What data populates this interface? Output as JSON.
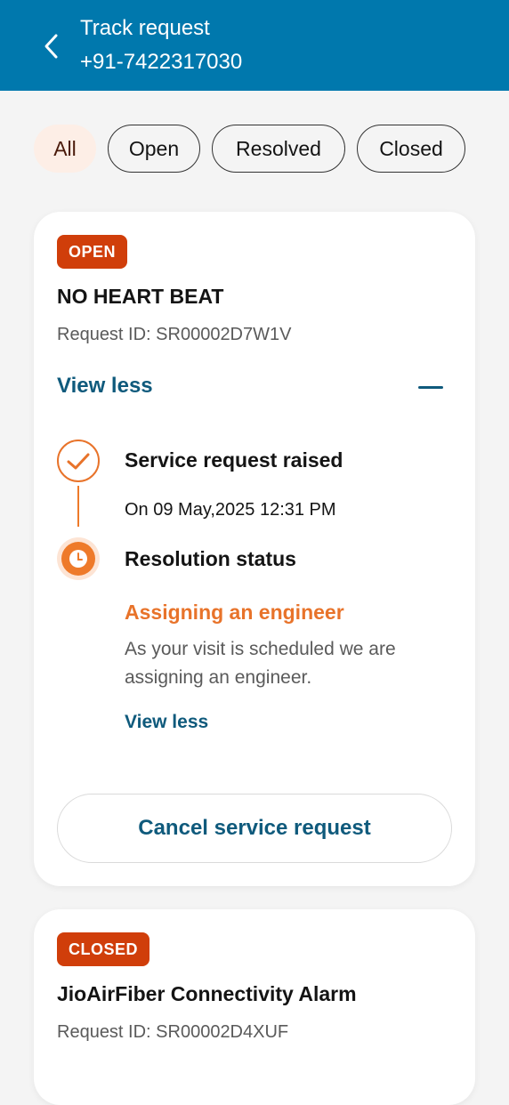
{
  "header": {
    "title": "Track request",
    "phone": "+91-7422317030"
  },
  "filters": [
    {
      "label": "All",
      "active": true
    },
    {
      "label": "Open",
      "active": false
    },
    {
      "label": "Resolved",
      "active": false
    },
    {
      "label": "Closed",
      "active": false
    }
  ],
  "requests": [
    {
      "status": "OPEN",
      "title": "NO HEART BEAT",
      "request_id": "Request ID: SR00002D7W1V",
      "toggle_label": "View less",
      "timeline": [
        {
          "title": "Service request raised",
          "detail": "On 09 May,2025 12:31 PM"
        },
        {
          "title": "Resolution status",
          "status": "Assigning an engineer",
          "description": "As your visit is scheduled we are assigning an engineer.",
          "link": "View less"
        }
      ],
      "cancel_label": "Cancel service request"
    },
    {
      "status": "CLOSED",
      "title": "JioAirFiber Connectivity Alarm",
      "request_id": "Request ID: SR00002D4XUF"
    }
  ],
  "colors": {
    "header_bg": "#0078ad",
    "badge_bg": "#d03e0a",
    "accent_orange": "#e8732a",
    "link_blue": "#0f5a7c"
  }
}
